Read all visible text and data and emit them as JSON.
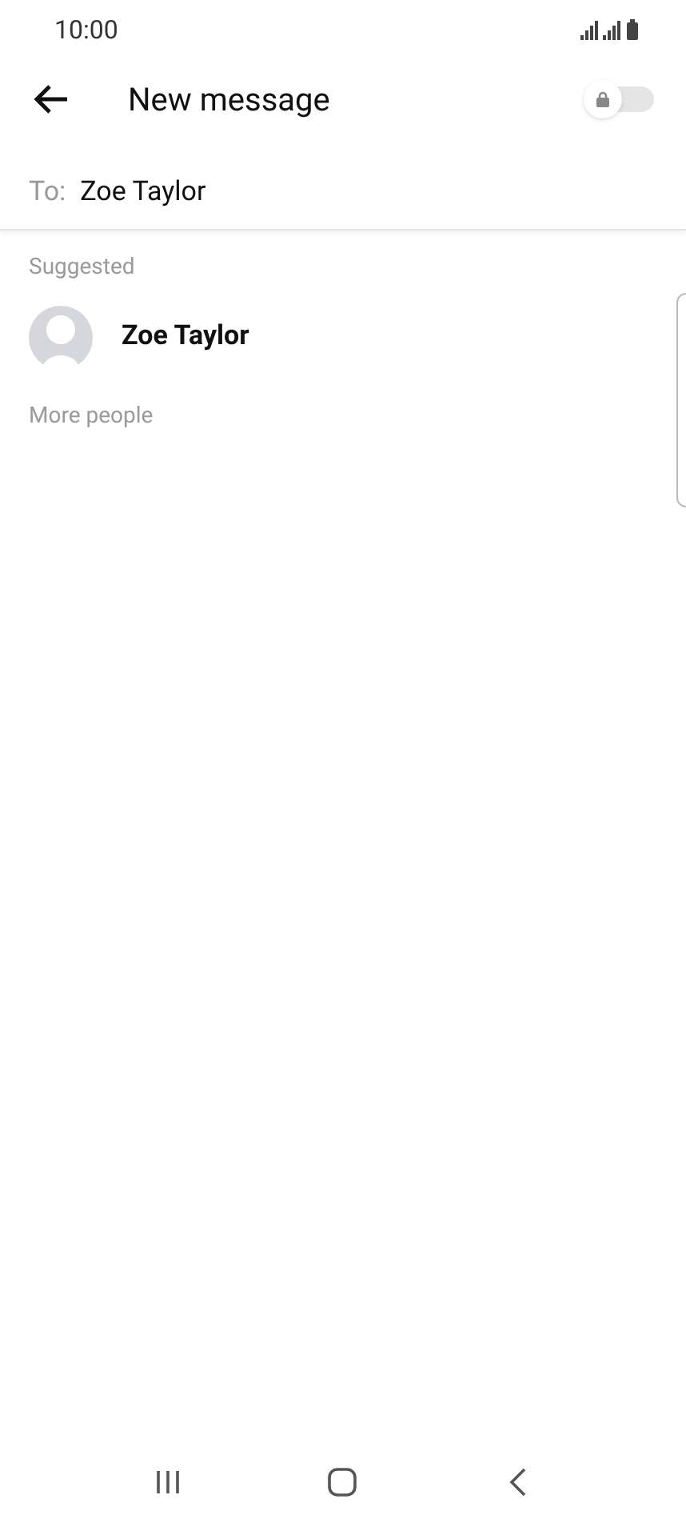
{
  "status_bar": {
    "time": "10:00"
  },
  "header": {
    "title": "New message",
    "secret_toggle": {
      "on": false
    }
  },
  "to_field": {
    "label": "To:",
    "value": "Zoe Taylor"
  },
  "suggested": {
    "heading": "Suggested",
    "contacts": [
      {
        "name": "Zoe Taylor"
      }
    ]
  },
  "more_people": {
    "heading": "More people"
  }
}
